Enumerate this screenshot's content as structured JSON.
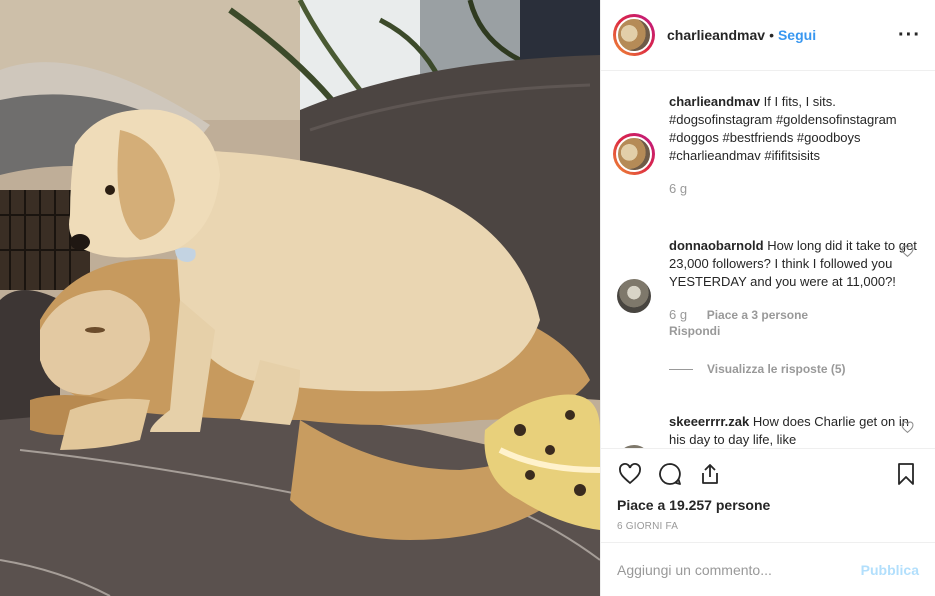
{
  "post": {
    "username": "charlieandmav",
    "follow_label": "Segui",
    "more_icon": "more-horizontal-icon"
  },
  "caption": {
    "username": "charlieandmav",
    "text": "If I fits, I sits. #dogsofinstagram #goldensofinstagram #doggos #bestfriends #goodboys #charlieandmav #ififitsisits",
    "time": "6 g"
  },
  "comments": [
    {
      "username": "donnaobarnold",
      "text": "How long did it take to get 23,000 followers? I think I followed you YESTERDAY and you were at 11,000?!",
      "time": "6 g",
      "likes": "Piace a 3 persone",
      "reply_label": "Rispondi",
      "view_replies": "Visualizza le risposte (5)"
    },
    {
      "username": "skeeerrrr.zak",
      "text": "How does Charlie get on in his day to day life, like"
    }
  ],
  "actions": {
    "like_icon": "heart-icon",
    "comment_icon": "comment-icon",
    "share_icon": "share-icon",
    "save_icon": "bookmark-icon",
    "likes_text": "Piace a 19.257 persone",
    "time_ago": "6 GIORNI FA"
  },
  "add_comment": {
    "placeholder": "Aggiungi un commento...",
    "publish_label": "Pubblica"
  },
  "colors": {
    "accent": "#3897f0",
    "publish_disabled": "#b2dffc",
    "muted": "#999999"
  }
}
